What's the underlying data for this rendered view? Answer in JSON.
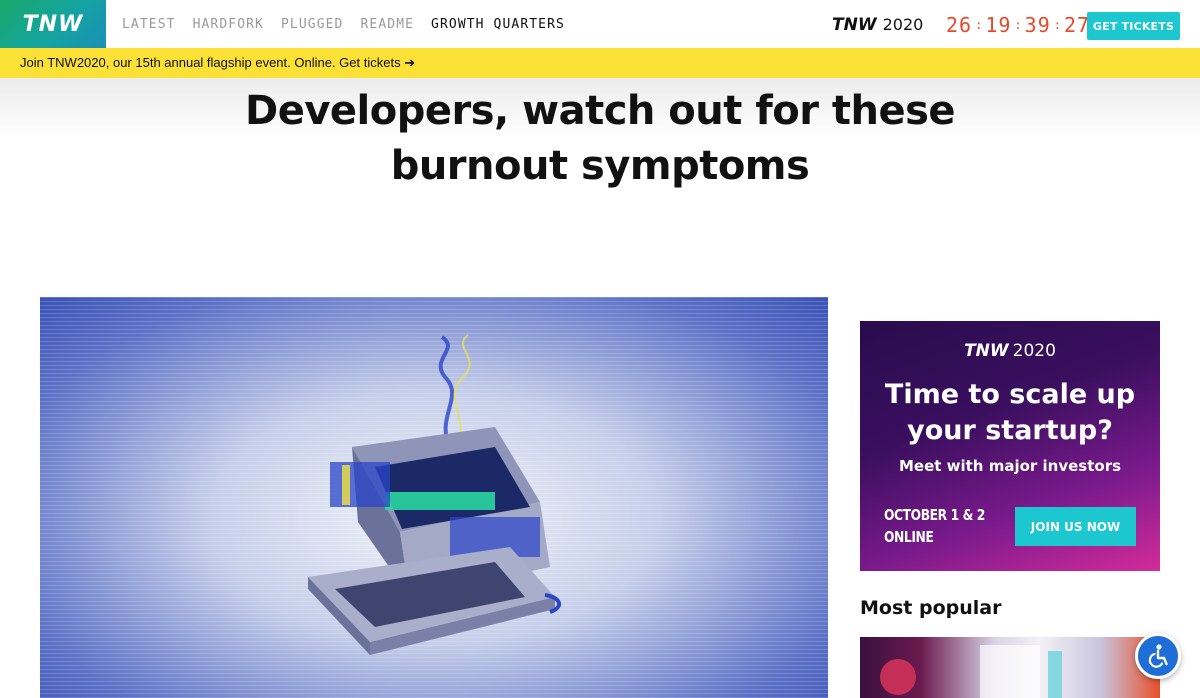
{
  "header": {
    "logo": "TNW",
    "nav": [
      "LATEST",
      "HARDFORK",
      "PLUGGED",
      "README",
      "GROWTH QUARTERS"
    ],
    "active_nav": "GROWTH QUARTERS",
    "event_brand": "TNW",
    "event_year": "2020",
    "countdown": {
      "days": "26",
      "hours": "19",
      "minutes": "39",
      "seconds": "27"
    },
    "tickets_label": "GET TICKETS"
  },
  "promo": {
    "text": "Join TNW2020, our 15th annual flagship event. Online. Get tickets ➔"
  },
  "article": {
    "title": "Developers, watch out for these burnout symptoms"
  },
  "ad": {
    "brand": "TNW",
    "year": "2020",
    "title": "Time to scale up your startup?",
    "subtitle": "Meet with major investors",
    "date_line1": "OCTOBER 1 & 2",
    "date_line2": "ONLINE",
    "button": "JOIN US NOW"
  },
  "sidebar": {
    "most_popular_heading": "Most popular"
  },
  "colors": {
    "accent": "#1cc7d0",
    "promo_bg": "#fbe135",
    "countdown": "#e8492b",
    "a11y": "#1f6dd6"
  },
  "icons": {
    "accessibility": "accessibility-icon"
  }
}
